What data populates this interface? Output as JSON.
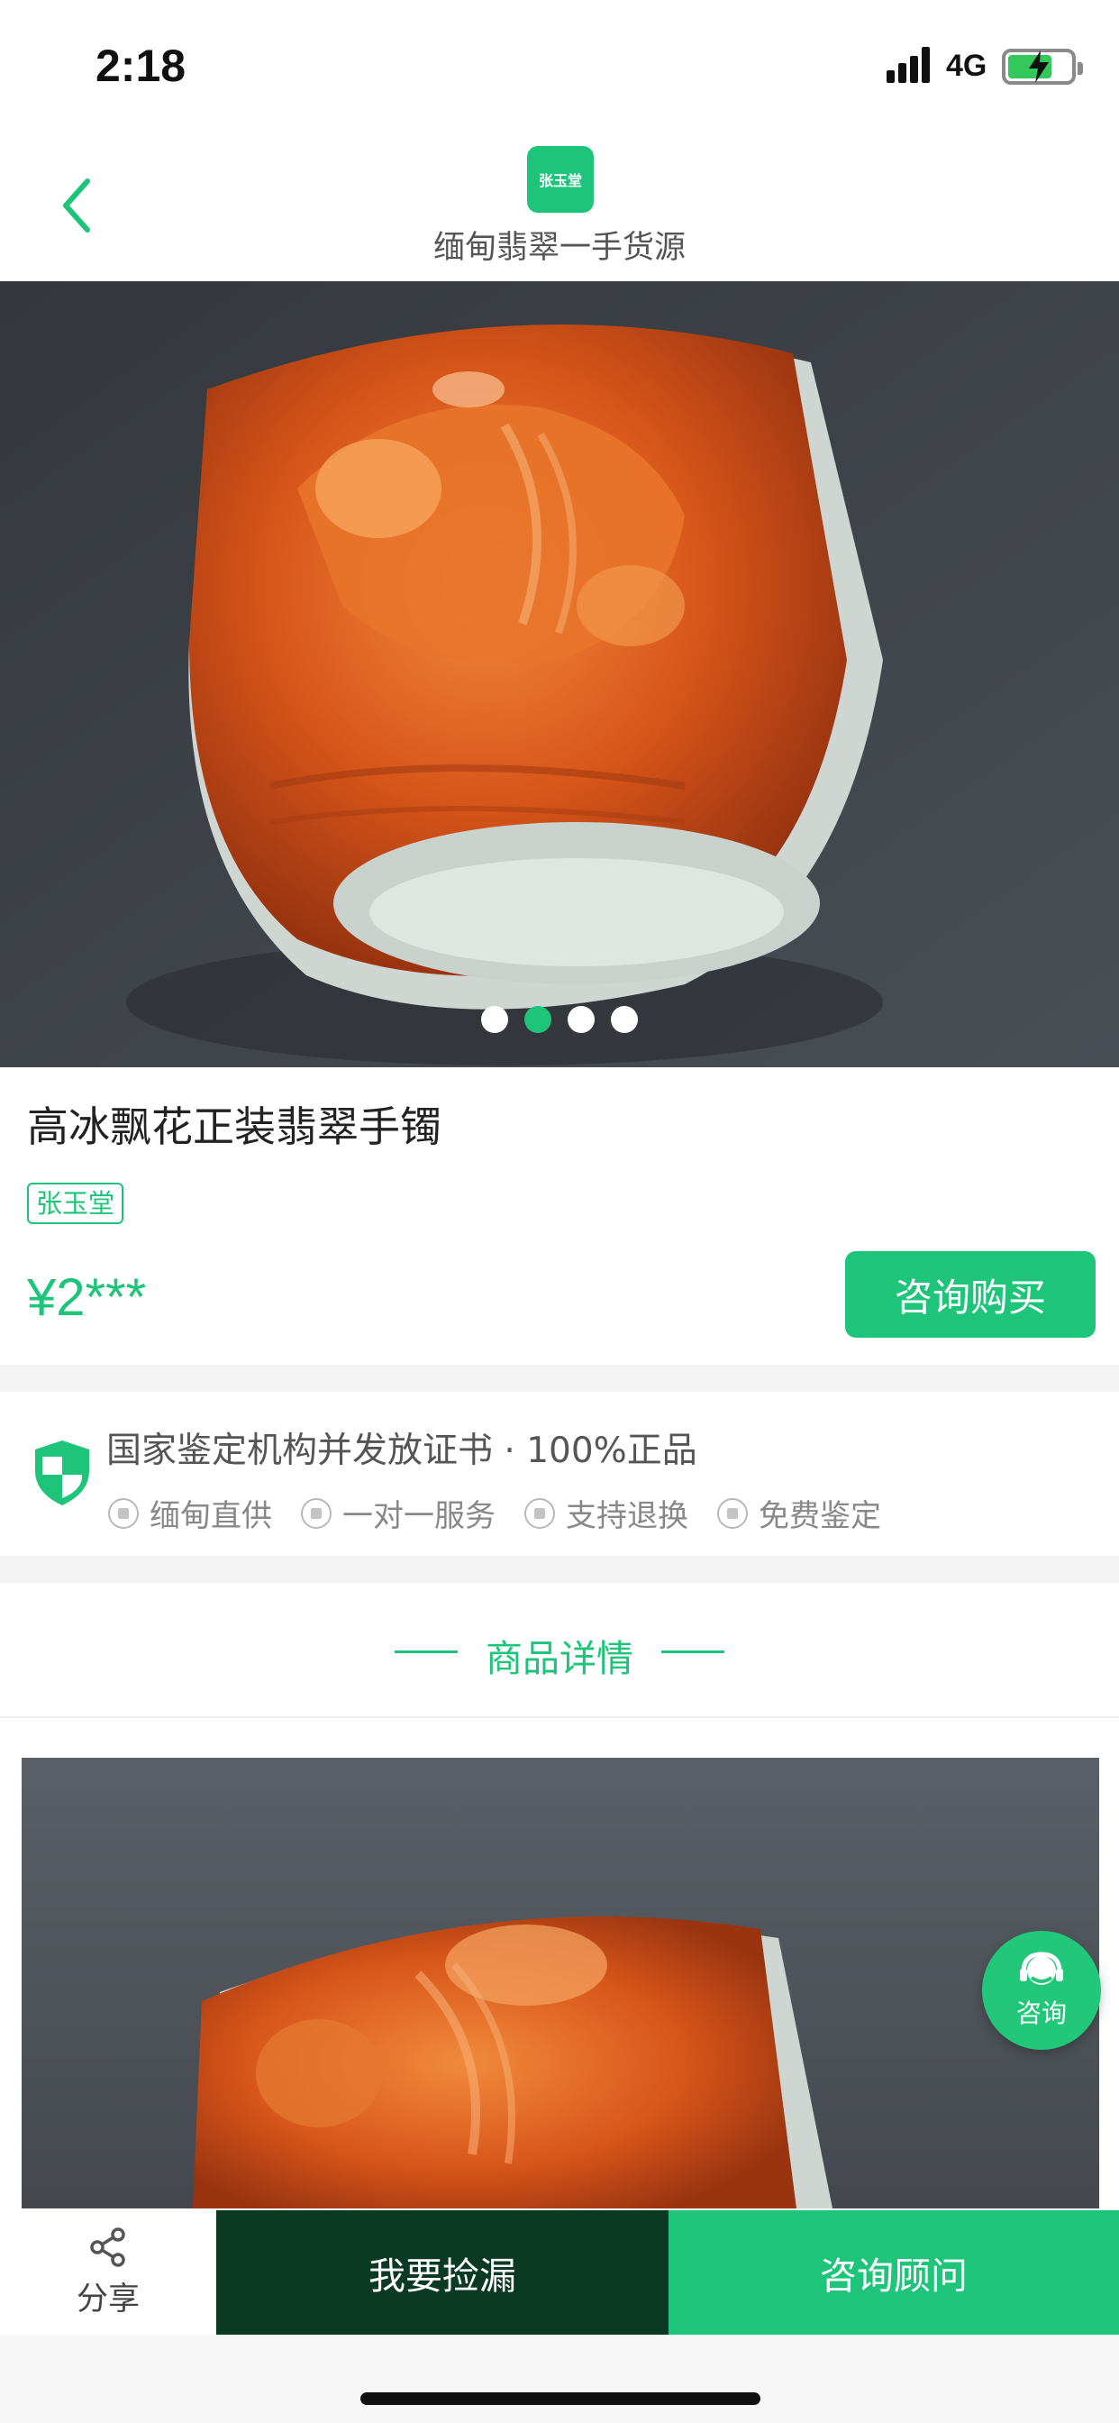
{
  "status_bar": {
    "time": "2:18",
    "network": "4G",
    "battery_level": 0.7
  },
  "nav": {
    "title": "缅甸翡翠一手货源",
    "logo_text": "张玉堂",
    "back_icon": "chevron-left-icon"
  },
  "hero": {
    "slide_count": 4,
    "active_slide": 2
  },
  "product": {
    "title": "高冰飘花正装翡翠手镯",
    "shop_tag": "张玉堂",
    "price": "¥2***",
    "buy_button": "咨询购买"
  },
  "guarantee": {
    "title": "国家鉴定机构并发放证书 · 100%正品",
    "features": [
      "缅甸直供",
      "一对一服务",
      "支持退换",
      "免费鉴定"
    ]
  },
  "detail": {
    "title": "商品详情"
  },
  "float_button": {
    "label": "咨询"
  },
  "bottom_bar": {
    "share": "分享",
    "grab": "我要捡漏",
    "advisor": "咨询顾问"
  },
  "colors": {
    "accent": "#1ec47a",
    "dark_green": "#0b3a24",
    "jade_orange": "#d8561a"
  }
}
